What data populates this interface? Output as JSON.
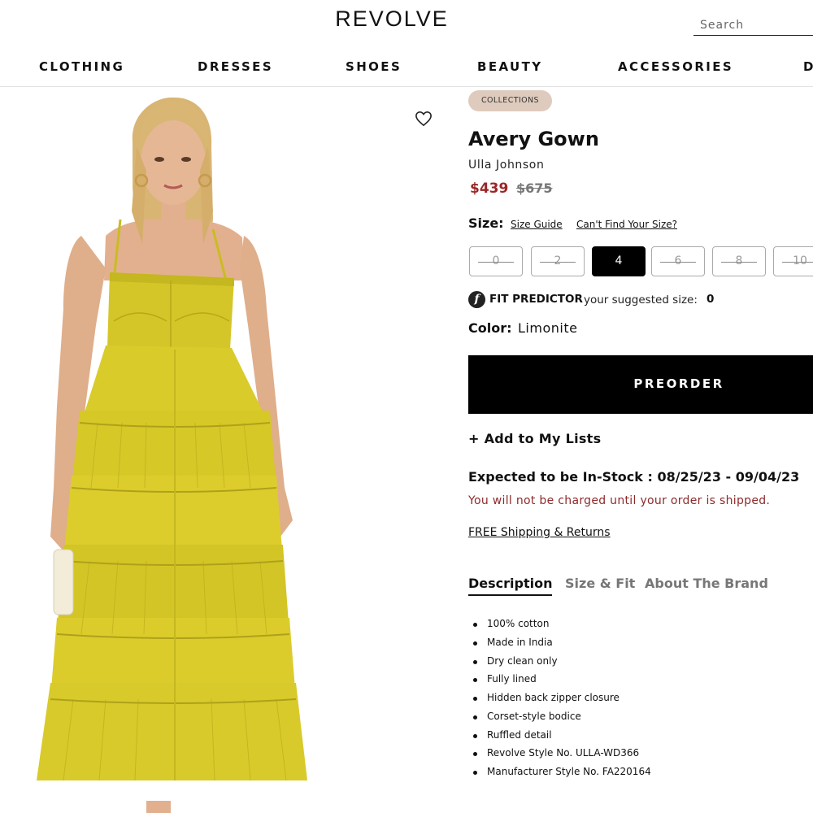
{
  "header": {
    "logo": "REVOLVE",
    "search_placeholder": "Search"
  },
  "nav": {
    "items": [
      "CLOTHING",
      "DRESSES",
      "SHOES",
      "BEAUTY",
      "ACCESSORIES",
      "D"
    ]
  },
  "product": {
    "badge": "COLLECTIONS",
    "title": "Avery Gown",
    "brand": "Ulla Johnson",
    "price": "$439",
    "old_price": "$675",
    "dress_color": "#dcce2a"
  },
  "size": {
    "label": "Size:",
    "guide_link": "Size Guide",
    "cant_find_link": "Can't Find Your Size?",
    "options": [
      {
        "label": "0",
        "state": "unavailable"
      },
      {
        "label": "2",
        "state": "unavailable"
      },
      {
        "label": "4",
        "state": "selected"
      },
      {
        "label": "6",
        "state": "unavailable"
      },
      {
        "label": "8",
        "state": "unavailable"
      },
      {
        "label": "10",
        "state": "unavailable"
      }
    ]
  },
  "fit_predictor": {
    "icon_letter": "f",
    "title": "FIT PREDICTOR",
    "text": "your suggested size:",
    "size": "0"
  },
  "color": {
    "label": "Color:",
    "value": "Limonite"
  },
  "actions": {
    "preorder_label": "PREORDER",
    "add_to_lists": "+ Add to My Lists"
  },
  "availability": {
    "instock": "Expected to be In-Stock : 08/25/23 - 09/04/23",
    "charge_note": "You will not be charged until your order is shipped.",
    "shipping_link": "FREE Shipping & Returns"
  },
  "tabs": [
    "Description",
    "Size & Fit",
    "About The Brand"
  ],
  "details": [
    "100% cotton",
    "Made in India",
    "Dry clean only",
    "Fully lined",
    "Hidden back zipper closure",
    "Corset-style bodice",
    "Ruffled detail",
    "Revolve Style No. ULLA-WD366",
    "Manufacturer Style No. FA220164"
  ],
  "colors": {
    "price_red": "#9b2626",
    "note_red": "#8e2a2a",
    "badge_bg": "#dfcbbd",
    "button_black": "#000000"
  }
}
